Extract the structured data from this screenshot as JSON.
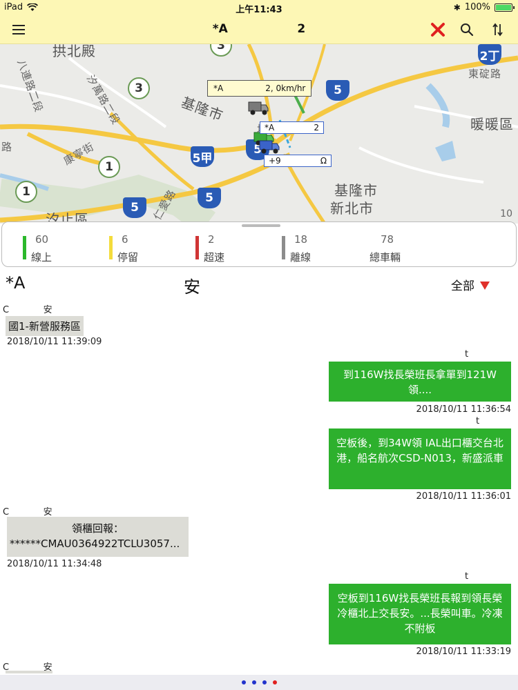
{
  "status_bar": {
    "device": "iPad",
    "time": "上午11:43",
    "battery": "100%",
    "battery_level": 1.0
  },
  "nav": {
    "title": "*A                 2"
  },
  "map": {
    "labels": {
      "l1": "拱北殿",
      "l2": "基隆市",
      "l3": "暖暖區",
      "l4": "汐止區",
      "l5": "基隆市",
      "l6": "新北市",
      "l7": "汐萬路二段",
      "l8": "康寧街",
      "l9": "東碇路",
      "l10": "八連路二段",
      "l11": "仁愛路",
      "l12": "路",
      "l13": "堵"
    },
    "shields": {
      "s1": "2丁",
      "s2": "5",
      "s3": "5甲",
      "s4": "5",
      "s5": "5",
      "s6": "5"
    },
    "flowers": {
      "f1": "3",
      "f2": "3",
      "f3": "1",
      "f4": "1"
    },
    "callout": "*A                2, 0km/hr",
    "vehicle_labels": {
      "v1": "*A               2",
      "v2": "+9               Ω"
    },
    "scale": "10"
  },
  "legend": [
    {
      "count": "60",
      "label": "線上",
      "color": "#2bb82b"
    },
    {
      "count": "6",
      "label": "停留",
      "color": "#f4dc3c"
    },
    {
      "count": "2",
      "label": "超速",
      "color": "#d03535"
    },
    {
      "count": "18",
      "label": "離線",
      "color": "#8c8c8c"
    },
    {
      "count": "78",
      "label": "總車輛",
      "color": ""
    }
  ],
  "chat_header": {
    "title": "*A",
    "title_tail": "安",
    "filter": "全部"
  },
  "messages": {
    "m1": {
      "sender": "C            安",
      "text": "國1-新營服務區",
      "time": "2018/10/11 11:39:09"
    },
    "m2": {
      "sender": "t",
      "text": "到116W找長榮班長拿單到121W領....",
      "time": "2018/10/11 11:36:54"
    },
    "m3": {
      "sender": "t",
      "text": "空板後，到34W領 IAL出口櫃交台北港，船名航次CSD-N013，新盛派車",
      "time": "2018/10/11 11:36:01"
    },
    "m4": {
      "sender": "C            安",
      "text_line1": "領櫃回報：",
      "text_line2": "******CMAU0364922TCLU3057...",
      "time": "2018/10/11 11:34:48"
    },
    "m5": {
      "sender": "t",
      "text": "空板到116W找長榮班長報到領長榮冷櫃北上交長安。...長榮叫車。冷凍不附板",
      "time": "2018/10/11 11:33:19"
    },
    "m6": {
      "sender": "C            安"
    }
  },
  "colors": {
    "bar_bg": "#fdf7b5",
    "bubble_out": "#2db02d",
    "bubble_in": "#dcdcd6",
    "close_red": "#e02020"
  }
}
